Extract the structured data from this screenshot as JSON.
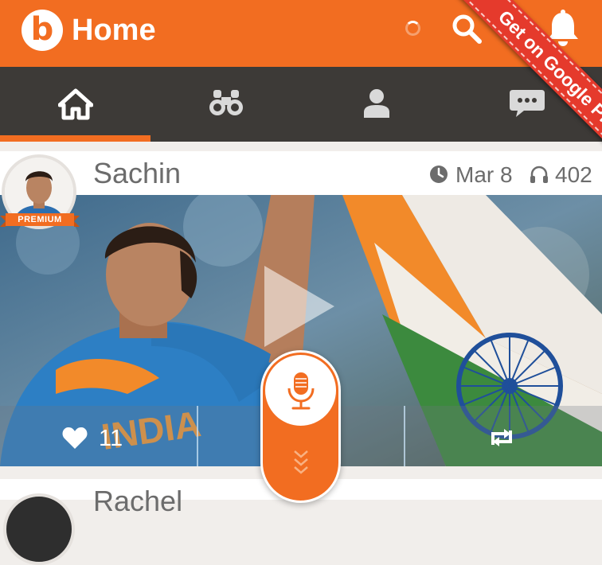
{
  "app_bar": {
    "title": "Home",
    "logo_letter": "b",
    "color": "#f26d21",
    "icons": [
      "loading-spinner",
      "search-icon",
      "bell-icon"
    ]
  },
  "promo_ribbon": {
    "label": "Get on Google Play",
    "color": "#e53a2c"
  },
  "tabs": [
    {
      "name": "home",
      "icon": "home-icon",
      "selected": true
    },
    {
      "name": "explore",
      "icon": "binoculars-icon",
      "selected": false
    },
    {
      "name": "profile",
      "icon": "person-icon",
      "selected": false
    },
    {
      "name": "messages",
      "icon": "chat-icon",
      "selected": false
    }
  ],
  "posts": [
    {
      "author": "Sachin",
      "badge": "PREMIUM",
      "date": "Mar 8",
      "listens": "402",
      "likes": "11"
    },
    {
      "author": "Rachel"
    }
  ],
  "colors": {
    "accent": "#f26d21",
    "tabbar": "#3d3a37",
    "background": "#f1eeeb"
  }
}
